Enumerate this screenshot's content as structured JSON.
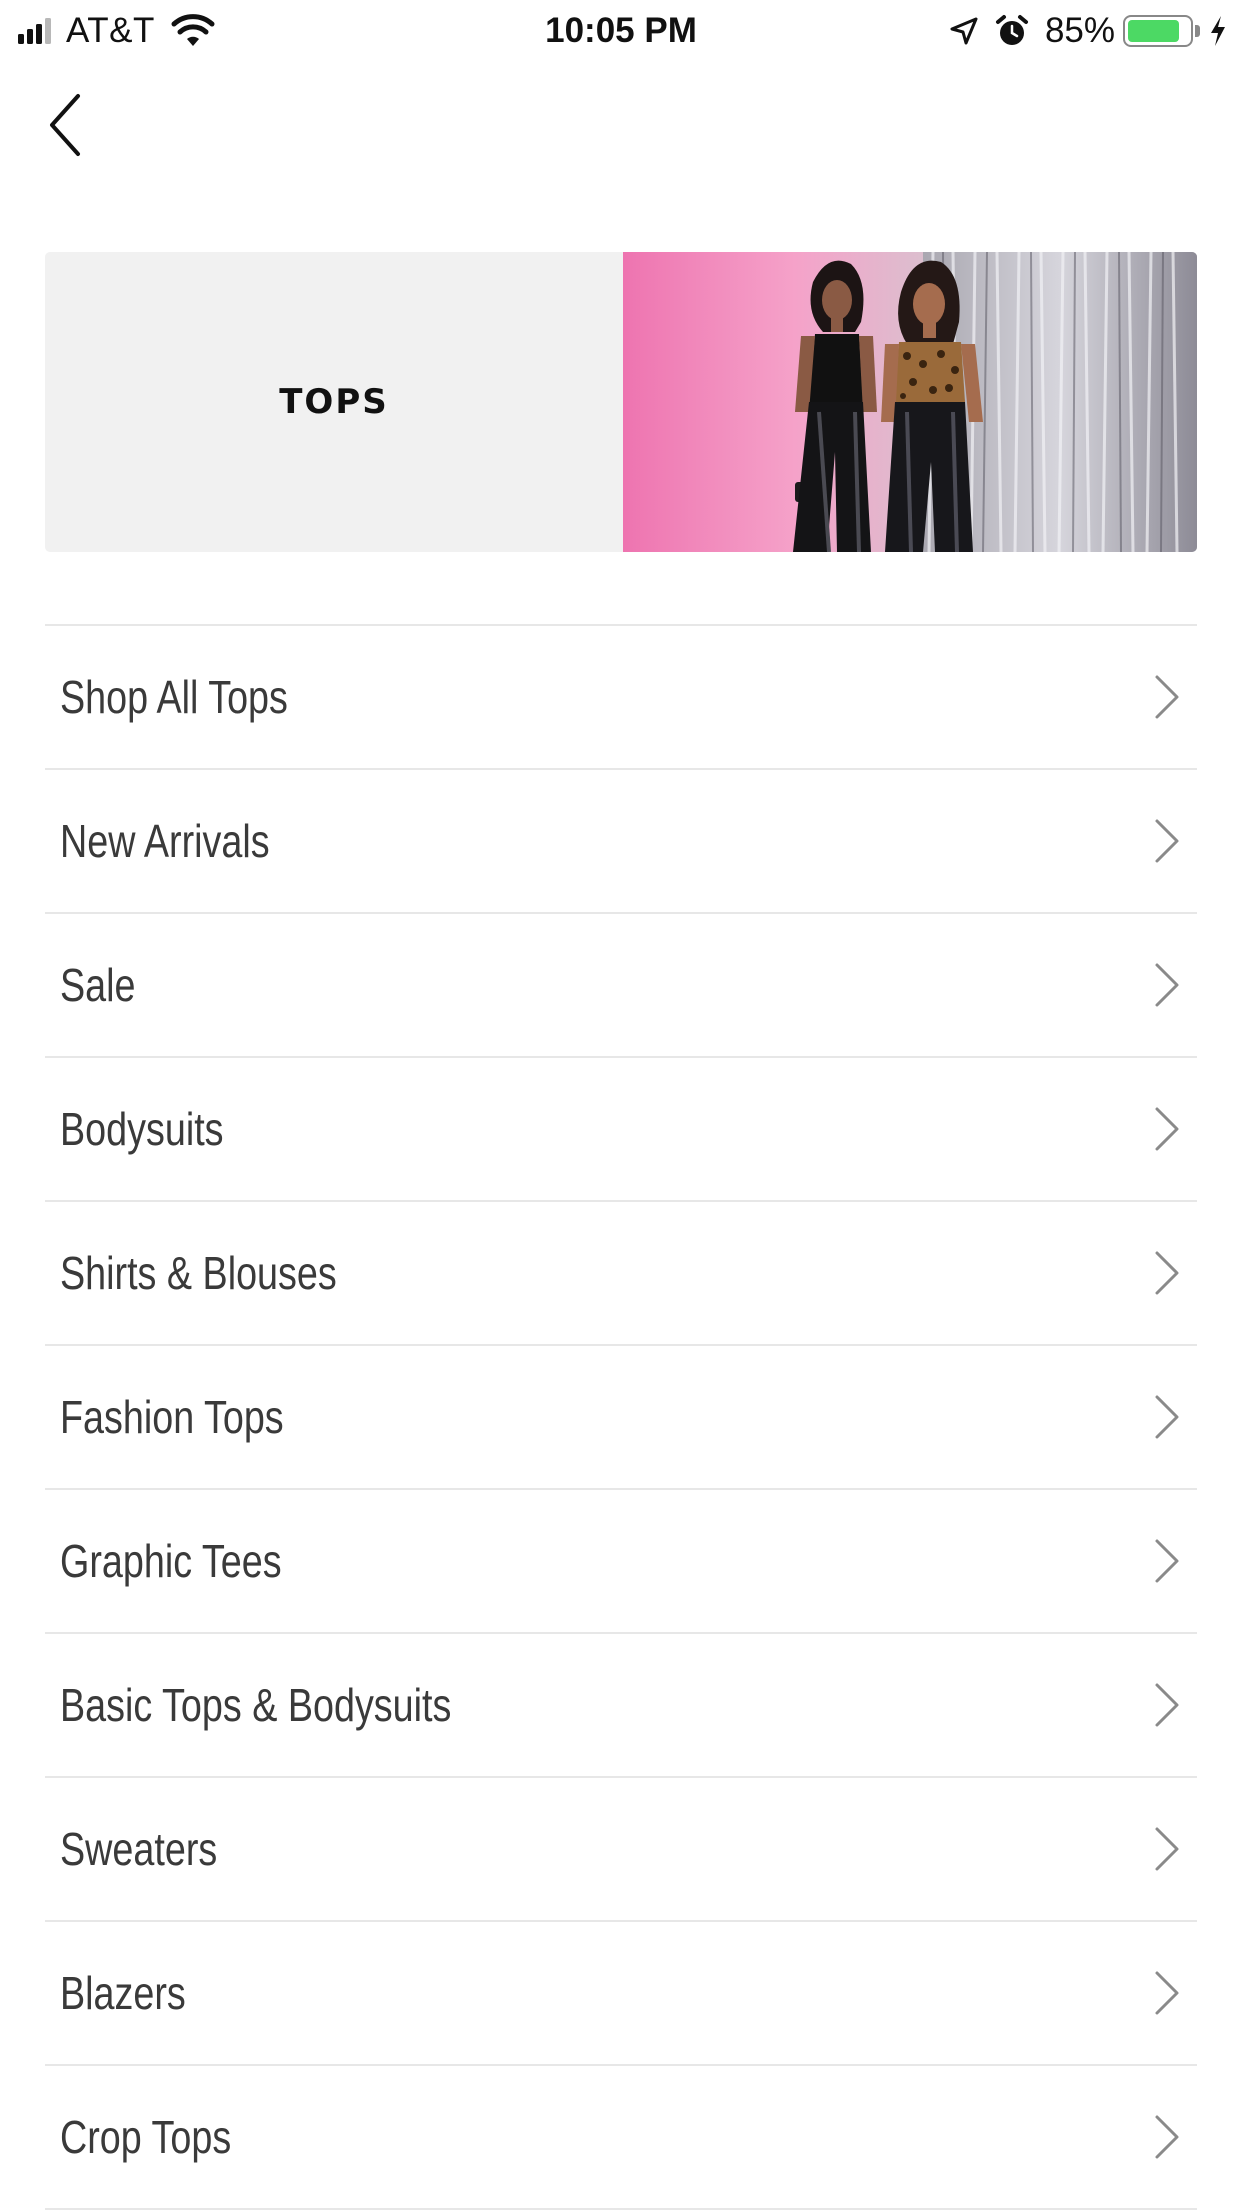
{
  "status_bar": {
    "carrier": "AT&T",
    "time": "10:05 PM",
    "battery_percent": "85%",
    "battery_level": 0.85,
    "signal_bars_active": 3,
    "signal_bars_total": 4,
    "icons": [
      "signal-icon",
      "wifi-icon",
      "location-icon",
      "alarm-icon",
      "battery-icon",
      "charging-bolt-icon"
    ]
  },
  "header": {
    "back_icon": "chevron-left-icon"
  },
  "banner": {
    "title": "TOPS",
    "background_color": "#f1f1f1"
  },
  "menu": {
    "items": [
      {
        "label": "Shop All Tops"
      },
      {
        "label": "New Arrivals"
      },
      {
        "label": "Sale"
      },
      {
        "label": "Bodysuits"
      },
      {
        "label": "Shirts & Blouses"
      },
      {
        "label": "Fashion Tops"
      },
      {
        "label": "Graphic Tees"
      },
      {
        "label": "Basic Tops & Bodysuits"
      },
      {
        "label": "Sweaters"
      },
      {
        "label": "Blazers"
      },
      {
        "label": "Crop Tops"
      }
    ],
    "chevron_icon": "chevron-right-icon",
    "divider_color": "#e7e7e7",
    "text_color": "#3a3a3a"
  }
}
